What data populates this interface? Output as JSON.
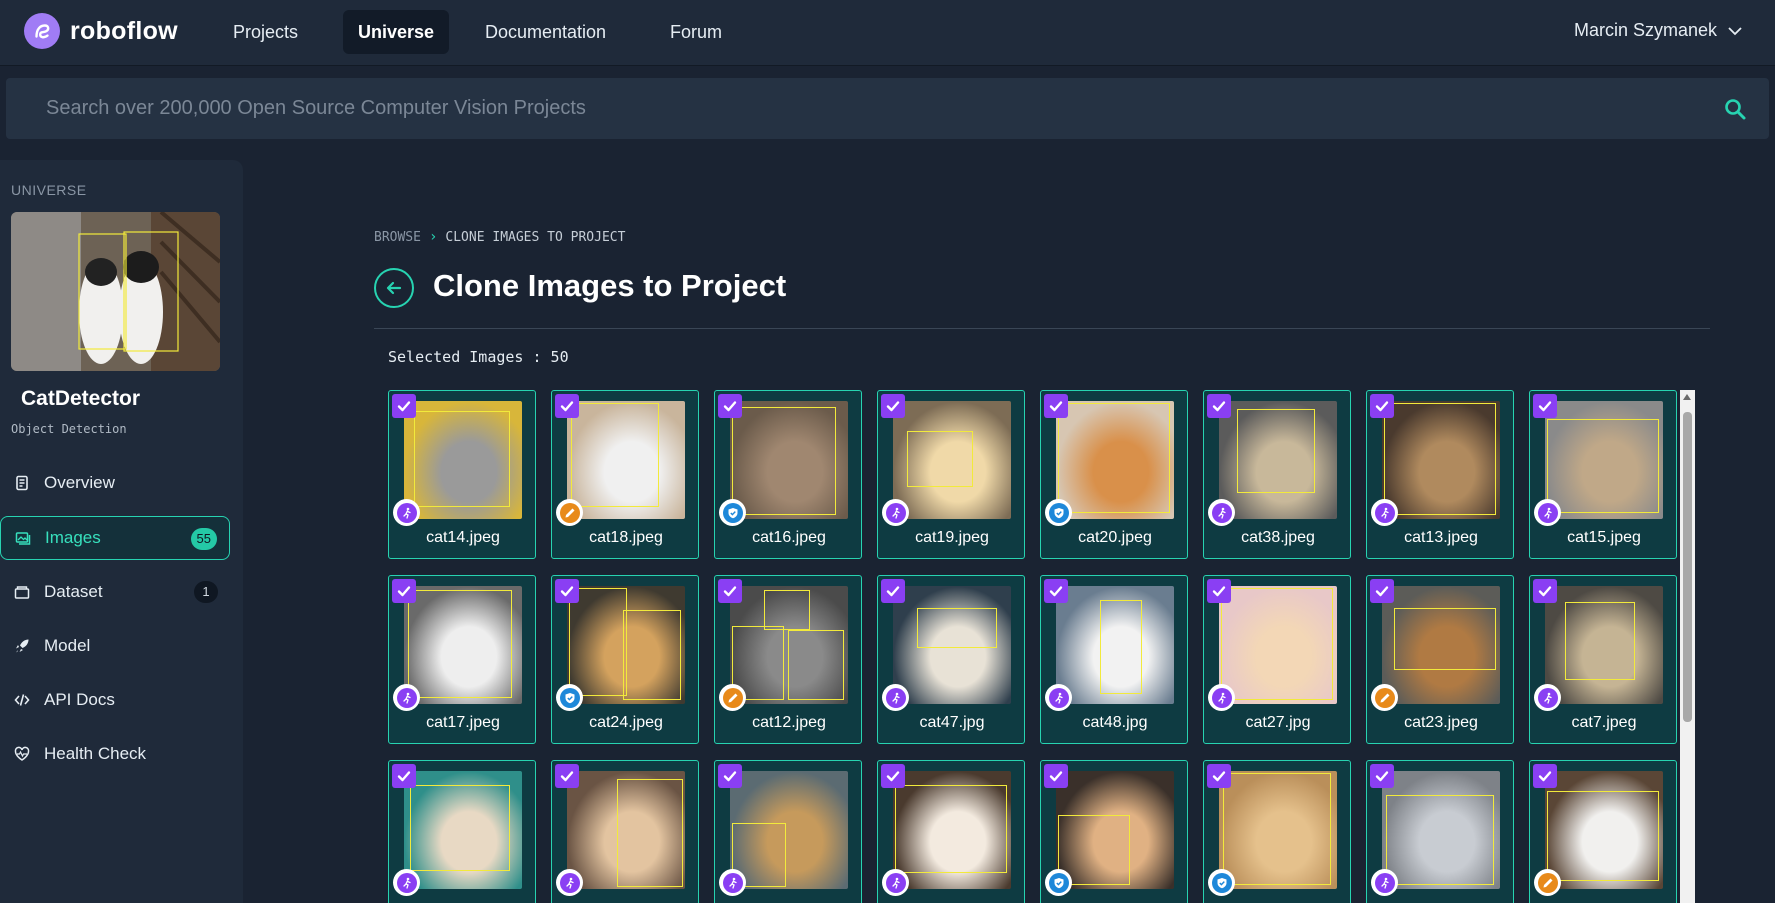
{
  "topnav": {
    "brand": "roboflow",
    "links": [
      {
        "label": "Projects",
        "active": false
      },
      {
        "label": "Universe",
        "active": true
      },
      {
        "label": "Documentation",
        "active": false
      },
      {
        "label": "Forum",
        "active": false
      }
    ],
    "user_name": "Marcin Szymanek"
  },
  "search": {
    "placeholder": "Search over 200,000 Open Source Computer Vision Projects",
    "value": ""
  },
  "sidebar": {
    "section_label": "UNIVERSE",
    "project_name": "CatDetector",
    "project_type": "Object Detection",
    "items": [
      {
        "label": "Overview",
        "icon": "document-icon",
        "badge": null
      },
      {
        "label": "Images",
        "icon": "images-icon",
        "badge": "55",
        "active": true
      },
      {
        "label": "Dataset",
        "icon": "dataset-icon",
        "badge": "1"
      },
      {
        "label": "Model",
        "icon": "rocket-icon",
        "badge": null
      },
      {
        "label": "API Docs",
        "icon": "code-icon",
        "badge": null
      },
      {
        "label": "Health Check",
        "icon": "heartbeat-icon",
        "badge": null
      }
    ]
  },
  "main": {
    "breadcrumb": {
      "browse": "BROWSE",
      "current": "CLONE IMAGES TO PROJECT"
    },
    "title": "Clone Images to Project",
    "selected_label": "Selected Images : 50"
  },
  "colors": {
    "accent": "#27d3b1",
    "checkbox": "#8a3ff3",
    "card_bg": "#0e3b42",
    "bbox": "#f2ea3b",
    "status_split": "#8a3ff3",
    "status_annotated": "#1e88d9",
    "status_edit": "#e88a1a"
  },
  "images": [
    {
      "name": "cat14.jpeg",
      "status": "split"
    },
    {
      "name": "cat18.jpeg",
      "status": "edit"
    },
    {
      "name": "cat16.jpeg",
      "status": "annotated"
    },
    {
      "name": "cat19.jpeg",
      "status": "split"
    },
    {
      "name": "cat20.jpeg",
      "status": "annotated"
    },
    {
      "name": "cat38.jpeg",
      "status": "split"
    },
    {
      "name": "cat13.jpeg",
      "status": "split"
    },
    {
      "name": "cat15.jpeg",
      "status": "split"
    },
    {
      "name": "cat17.jpeg",
      "status": "split"
    },
    {
      "name": "cat24.jpeg",
      "status": "annotated"
    },
    {
      "name": "cat12.jpeg",
      "status": "edit"
    },
    {
      "name": "cat47.jpg",
      "status": "split"
    },
    {
      "name": "cat48.jpg",
      "status": "split"
    },
    {
      "name": "cat27.jpg",
      "status": "split"
    },
    {
      "name": "cat23.jpeg",
      "status": "edit"
    },
    {
      "name": "cat7.jpeg",
      "status": "split"
    },
    {
      "name": "",
      "status": "split"
    },
    {
      "name": "",
      "status": "split"
    },
    {
      "name": "",
      "status": "split"
    },
    {
      "name": "",
      "status": "split"
    },
    {
      "name": "",
      "status": "annotated"
    },
    {
      "name": "",
      "status": "annotated"
    },
    {
      "name": "",
      "status": "split"
    },
    {
      "name": "",
      "status": "edit"
    }
  ]
}
